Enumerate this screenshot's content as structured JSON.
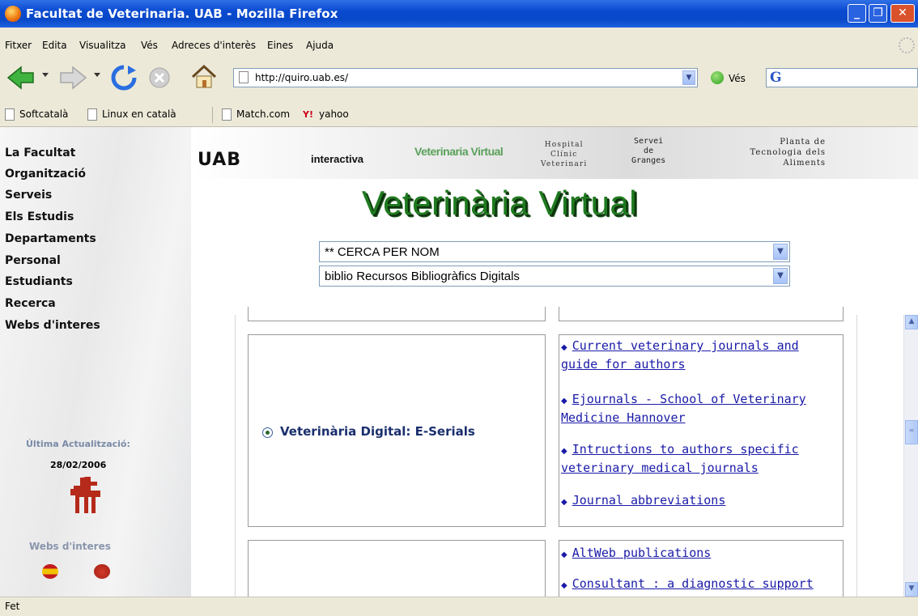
{
  "window": {
    "title": "Facultat de Veterinaria. UAB - Mozilla Firefox"
  },
  "menu": [
    "Fitxer",
    "Edita",
    "Visualitza",
    "Vés",
    "Adreces d'interès",
    "Eines",
    "Ajuda"
  ],
  "toolbar": {
    "url": "http://quiro.uab.es/",
    "go_label": "Vés",
    "search_glyph": "G"
  },
  "bookmarks": [
    "Softcatalà",
    "Linux en català",
    "Match.com",
    "yahoo"
  ],
  "sidebar": {
    "nav": [
      "La Facultat",
      "Organització",
      "Serveis",
      "Els Estudis",
      "Departaments",
      "Personal",
      "Estudiants",
      "Recerca",
      "Webs d'interes"
    ],
    "last_update_label": "Última Actualització:",
    "last_update_value": "28/02/2006",
    "webs_label": "Webs d'interes"
  },
  "banner": {
    "uab": "UAB",
    "interactiva": "interactiva",
    "vv_logo": "Veterinaria Virtual",
    "hospital": [
      "Hospital",
      "Clínic",
      "Veterinari"
    ],
    "servei": [
      "Servei",
      "de",
      "Granges"
    ],
    "planta": [
      "Planta de",
      "Tecnologia dels",
      "Aliments"
    ]
  },
  "page_title": "Veterinària Virtual",
  "selects": {
    "cerca": "** CERCA PER NOM",
    "biblio": "biblio Recursos Bibliogràfics Digitals"
  },
  "section": {
    "serials_label": "Veterinària Digital: E-Serials"
  },
  "links_group1": [
    [
      "Current veterinary journals and",
      "guide for authors"
    ],
    [
      "Ejournals - School of Veterinary",
      "Medicine Hannover"
    ],
    [
      "Intructions to authors specific",
      "veterinary medical journals"
    ],
    [
      "Journal abbreviations"
    ]
  ],
  "links_group2": [
    [
      "AltWeb publications"
    ],
    [
      "Consultant : a diagnostic support"
    ]
  ],
  "status": "Fet"
}
